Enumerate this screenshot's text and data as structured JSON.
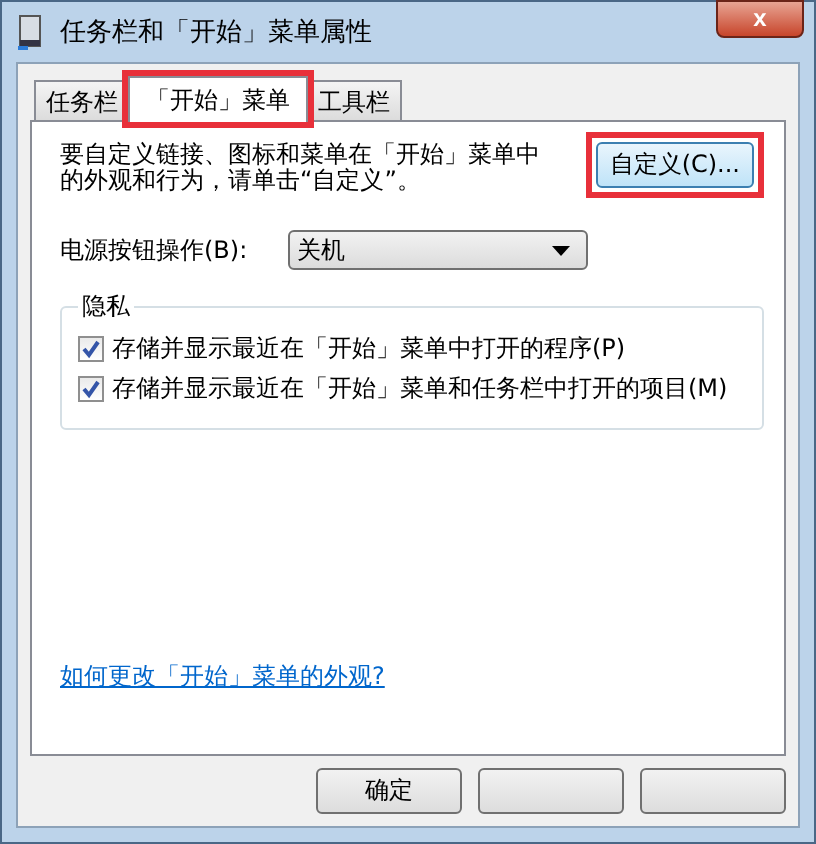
{
  "window": {
    "title": "任务栏和「开始」菜单属性",
    "close": "x"
  },
  "tabs": [
    {
      "label": "任务栏",
      "selected": false,
      "highlighted": false
    },
    {
      "label": "「开始」菜单",
      "selected": true,
      "highlighted": true
    },
    {
      "label": "工具栏",
      "selected": false,
      "highlighted": false
    }
  ],
  "description": "要自定义链接、图标和菜单在「开始」菜单中的外观和行为，请单击“自定义”。",
  "customize_button": {
    "label": "自定义(C)...",
    "highlighted": true
  },
  "power_button": {
    "label": "电源按钮操作(B):",
    "value": "关机"
  },
  "privacy": {
    "title": "隐私",
    "options": [
      {
        "label": "存储并显示最近在「开始」菜单中打开的程序(P)",
        "checked": true
      },
      {
        "label": "存储并显示最近在「开始」菜单和任务栏中打开的项目(M)",
        "checked": true
      }
    ]
  },
  "help_link": "如何更改「开始」菜单的外观?",
  "buttons": [
    "确定"
  ]
}
